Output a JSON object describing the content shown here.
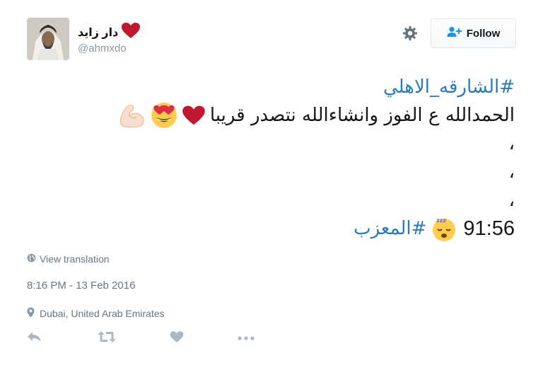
{
  "user": {
    "display_name": "دار زايد",
    "handle": "@ahmxdo",
    "name_badge_icon": "red-heart-icon"
  },
  "header": {
    "follow_label": "Follow",
    "follow_icon": "add-user-icon",
    "settings_icon": "gear-icon"
  },
  "tweet": {
    "hashtag_top": "#الشارقه_الاهلي",
    "main_text": "الحمدالله ع الفوز وانشاءالله نتصدر قريبا",
    "main_emojis": [
      "red-heart-icon",
      "red-heart-icon",
      "heart-eyes-emoji-icon",
      "flexed-biceps-icon"
    ],
    "comma_1": "،",
    "comma_2": "،",
    "comma_3": "،",
    "time_value": "91:56",
    "sleep_emoji": "sleeping-face-icon",
    "hashtag_bottom": "#المعزب"
  },
  "meta": {
    "translate_label": "View translation",
    "timestamp": "8:16 PM - 13 Feb 2016",
    "location": "Dubai, United Arab Emirates"
  },
  "actions": {
    "reply_icon": "reply-icon",
    "retweet_icon": "retweet-icon",
    "like_icon": "heart-icon",
    "more_icon": "more-icon"
  },
  "colors": {
    "link": "#2b7bb9",
    "muted": "#8899a6",
    "meta_text": "#657786",
    "heart": "#be1931",
    "text": "#14171a"
  }
}
